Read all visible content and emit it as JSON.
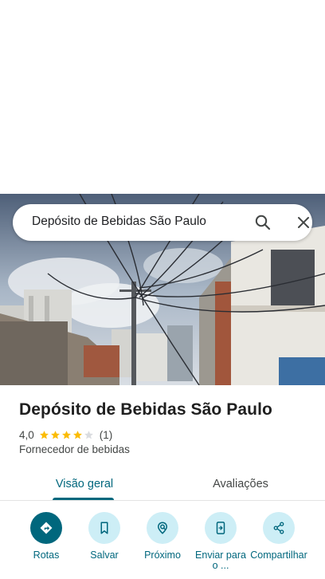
{
  "search": {
    "query": "Depósito de Bebidas São Paulo",
    "search_icon": "search-icon",
    "close_icon": "close-icon"
  },
  "place": {
    "title": "Depósito de Bebidas São Paulo",
    "rating": "4,0",
    "rating_stars": 4,
    "rating_max": 5,
    "review_count": "(1)",
    "category": "Fornecedor de bebidas"
  },
  "tabs": [
    {
      "label": "Visão geral",
      "active": true
    },
    {
      "label": "Avaliações",
      "active": false
    }
  ],
  "actions": [
    {
      "label": "Rotas",
      "icon": "directions-icon"
    },
    {
      "label": "Salvar",
      "icon": "bookmark-icon"
    },
    {
      "label": "Próximo",
      "icon": "nearby-icon"
    },
    {
      "label": "Enviar para o ...",
      "icon": "send-to-phone-icon"
    },
    {
      "label": "Compartilhar",
      "icon": "share-icon"
    }
  ],
  "colors": {
    "accent": "#00677d",
    "action_bg": "#cdeef6",
    "star": "#fbbc04",
    "star_empty": "#dadce0"
  }
}
